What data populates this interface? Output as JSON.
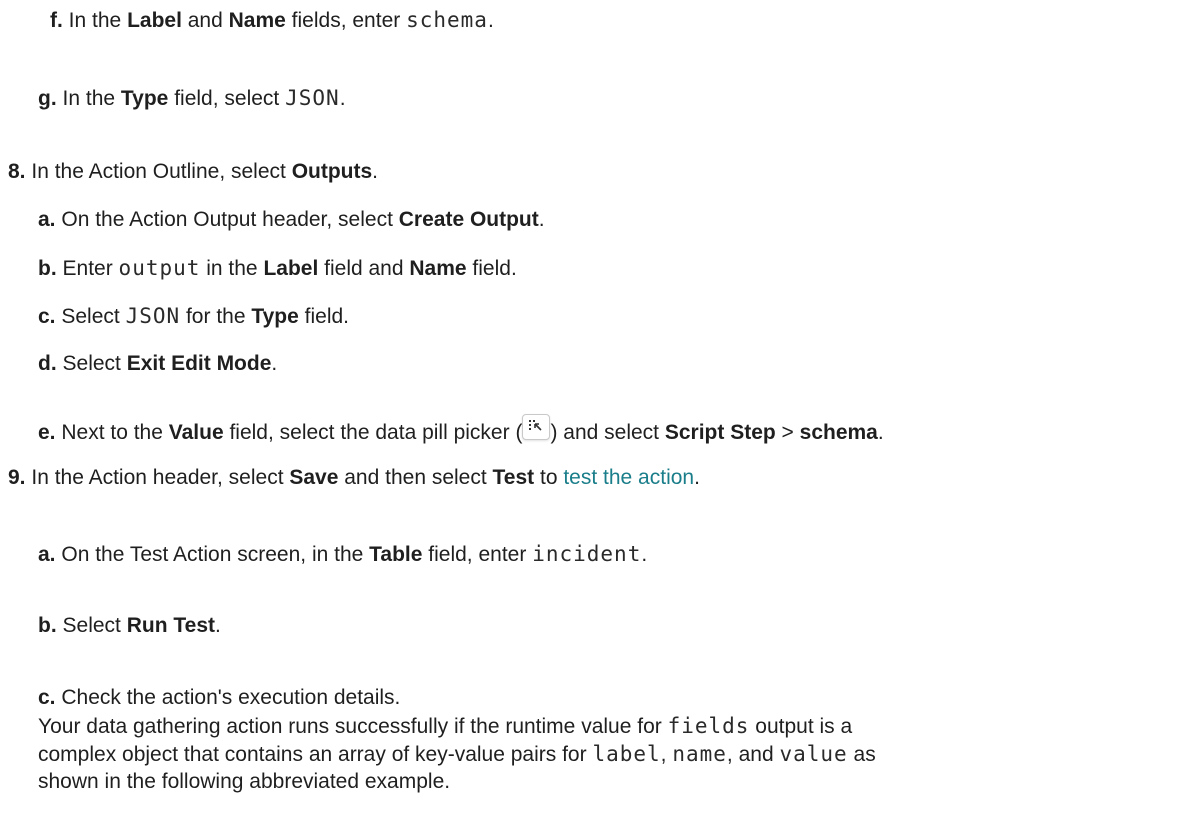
{
  "steps": [
    {
      "marker": "f.",
      "parts": [
        {
          "t": "In the "
        },
        {
          "b": "Label"
        },
        {
          "t": " and "
        },
        {
          "b": "Name"
        },
        {
          "t": " fields, enter "
        },
        {
          "c": "schema"
        },
        {
          "t": "."
        }
      ]
    },
    {
      "marker": "g.",
      "parts": [
        {
          "t": "In the "
        },
        {
          "b": "Type"
        },
        {
          "t": " field, select "
        },
        {
          "c": "JSON"
        },
        {
          "t": "."
        }
      ]
    },
    {
      "marker": "8.",
      "parts": [
        {
          "t": "In the Action Outline, select "
        },
        {
          "b": "Outputs"
        },
        {
          "t": "."
        }
      ]
    },
    {
      "marker": "a.",
      "parts": [
        {
          "t": "On the Action Output header, select "
        },
        {
          "b": "Create Output"
        },
        {
          "t": "."
        }
      ]
    },
    {
      "marker": "b.",
      "parts": [
        {
          "t": "Enter "
        },
        {
          "c": "output"
        },
        {
          "t": " in the "
        },
        {
          "b": "Label"
        },
        {
          "t": " field and "
        },
        {
          "b": "Name"
        },
        {
          "t": " field."
        }
      ]
    },
    {
      "marker": "c.",
      "parts": [
        {
          "t": "Select "
        },
        {
          "c": "JSON"
        },
        {
          "t": " for the "
        },
        {
          "b": "Type"
        },
        {
          "t": " field."
        }
      ]
    },
    {
      "marker": "d.",
      "parts": [
        {
          "t": "Select "
        },
        {
          "b": "Exit Edit Mode"
        },
        {
          "t": "."
        }
      ]
    },
    {
      "marker": "e.",
      "parts": [
        {
          "t": "Next to the "
        },
        {
          "b": "Value"
        },
        {
          "t": " field, select the data pill picker ("
        },
        {
          "icon": "data-pill-picker-icon"
        },
        {
          "t": ") and select "
        },
        {
          "b": "Script Step"
        },
        {
          "t": " > "
        },
        {
          "b": "schema"
        },
        {
          "t": "."
        }
      ]
    },
    {
      "marker": "9.",
      "parts": [
        {
          "t": "In the Action header, select "
        },
        {
          "b": "Save"
        },
        {
          "t": " and then select "
        },
        {
          "b": "Test"
        },
        {
          "t": " to "
        },
        {
          "link": "test the action"
        },
        {
          "t": "."
        }
      ]
    },
    {
      "marker": "a.",
      "parts": [
        {
          "t": "On the Test Action screen, in the "
        },
        {
          "b": "Table"
        },
        {
          "t": " field, enter "
        },
        {
          "c": "incident"
        },
        {
          "t": "."
        }
      ]
    },
    {
      "marker": "b.",
      "parts": [
        {
          "t": "Select "
        },
        {
          "b": "Run Test"
        },
        {
          "t": "."
        }
      ]
    },
    {
      "marker": "c.",
      "parts": [
        {
          "t": "Check the action's execution details."
        }
      ]
    },
    {
      "marker": "",
      "parts": [
        {
          "t": "Your data gathering action runs successfully if the runtime value for "
        },
        {
          "c": "fields"
        },
        {
          "t": " output is a"
        }
      ]
    },
    {
      "marker": "",
      "parts": [
        {
          "t": "complex object that contains an array of key-value pairs for "
        },
        {
          "c": "label"
        },
        {
          "t": ", "
        },
        {
          "c": "name"
        },
        {
          "t": ", and "
        },
        {
          "c": "value"
        },
        {
          "t": " as"
        }
      ]
    },
    {
      "marker": "",
      "parts": [
        {
          "t": "shown in the following abbreviated example."
        }
      ]
    }
  ]
}
